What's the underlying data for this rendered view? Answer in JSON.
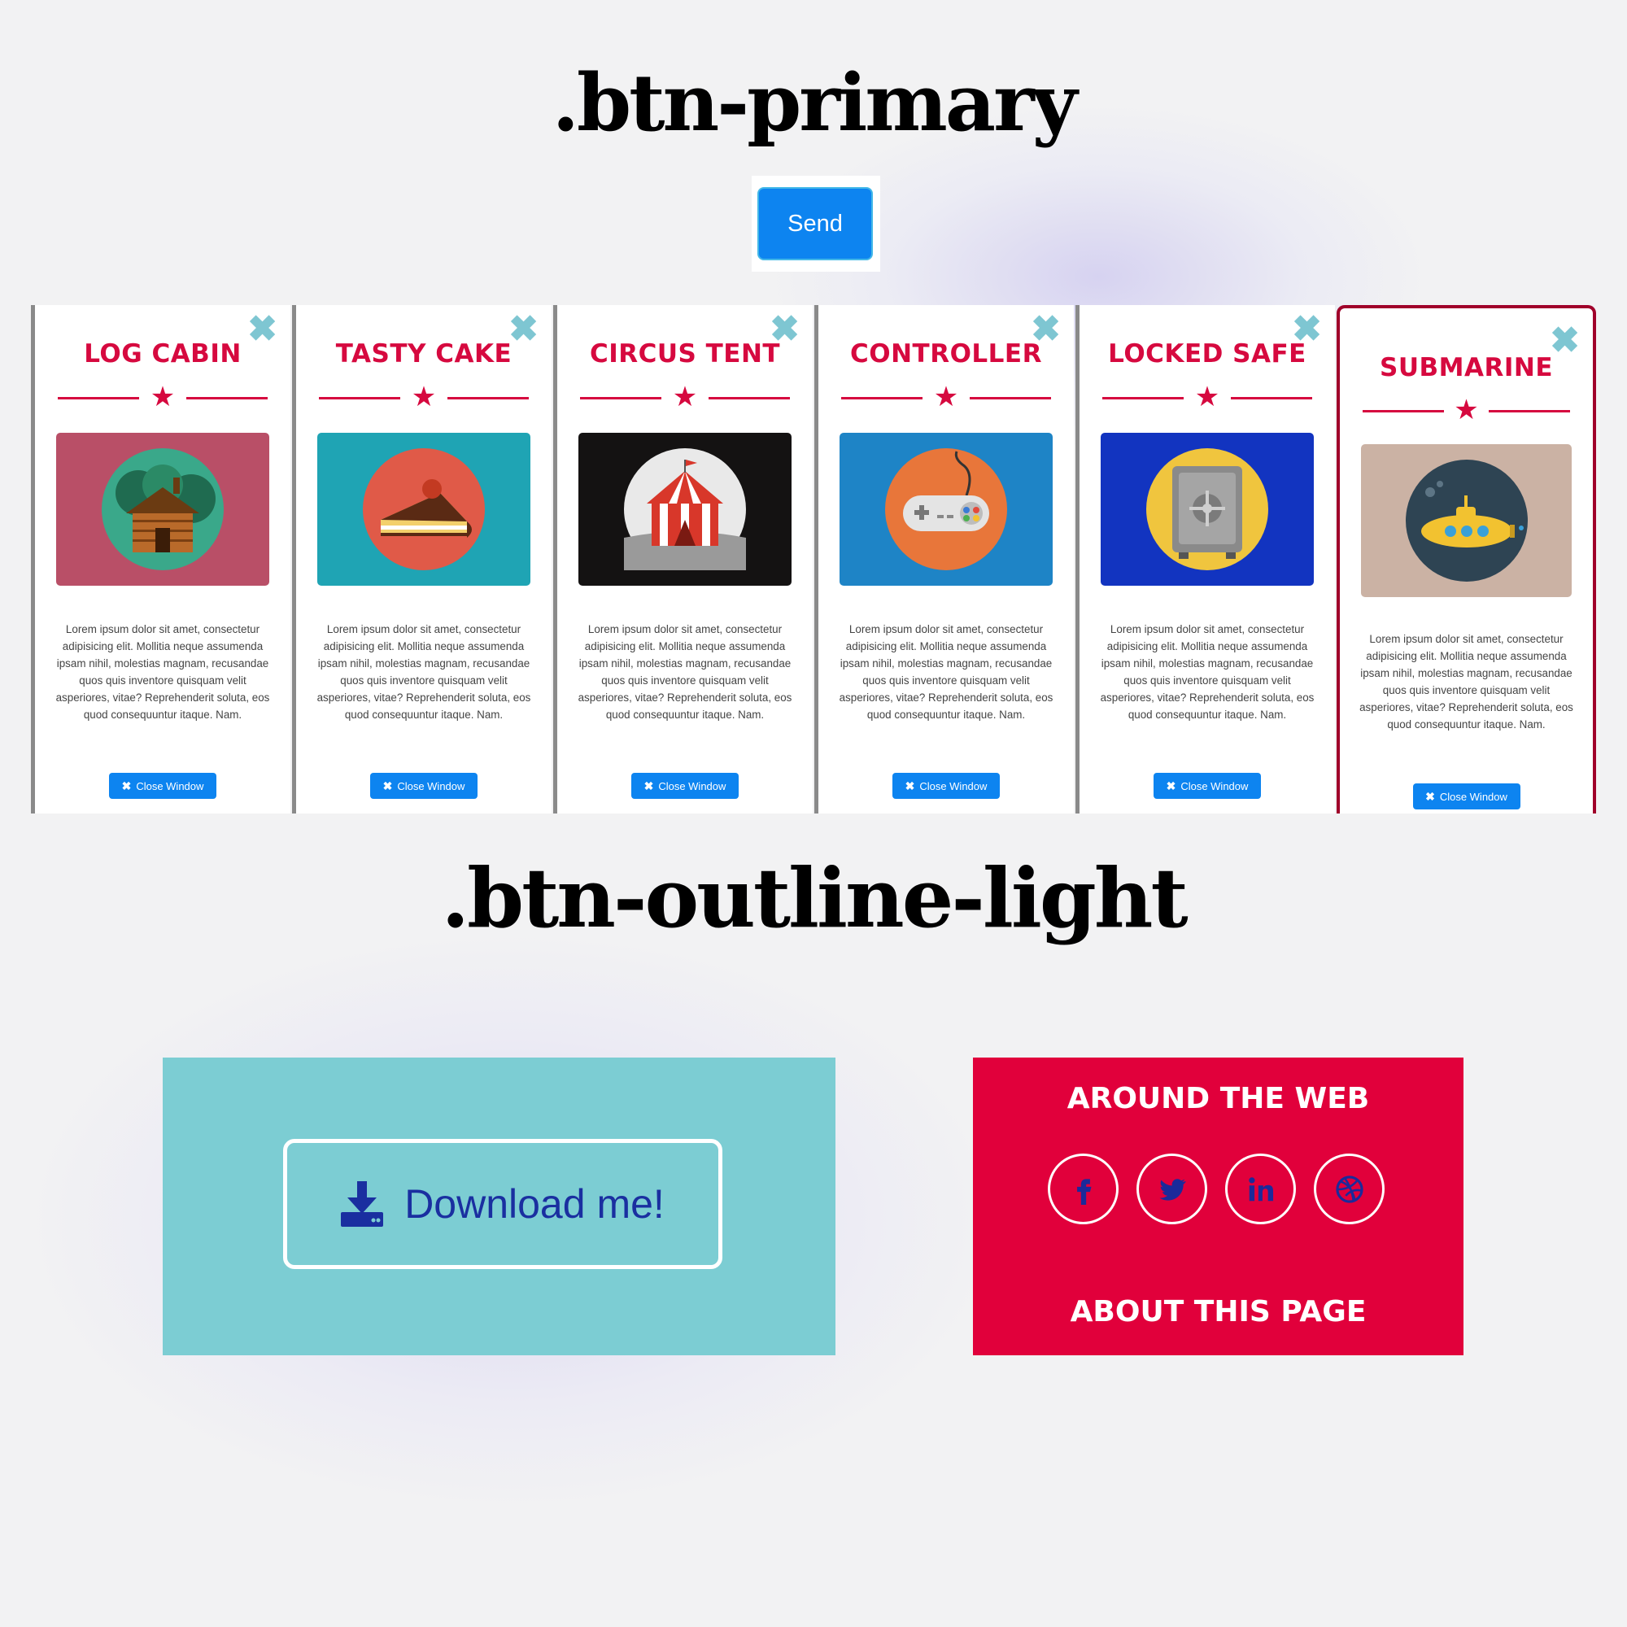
{
  "headings": {
    "primary": ".btn-primary",
    "outline": ".btn-outline-light"
  },
  "send_button": {
    "label": "Send"
  },
  "cards": [
    {
      "title": "LOG CABIN",
      "art_bg": "#b94f67",
      "icon": "log-cabin-icon"
    },
    {
      "title": "TASTY CAKE",
      "art_bg": "#1fa4b4",
      "icon": "cake-icon"
    },
    {
      "title": "CIRCUS TENT",
      "art_bg": "#141212",
      "icon": "circus-tent-icon"
    },
    {
      "title": "CONTROLLER",
      "art_bg": "#1e84c6",
      "icon": "controller-icon"
    },
    {
      "title": "LOCKED SAFE",
      "art_bg": "#1234c0",
      "icon": "safe-icon"
    },
    {
      "title": "SUBMARINE",
      "art_bg": "#cbb2a4",
      "icon": "submarine-icon"
    }
  ],
  "card_common": {
    "description": "Lorem ipsum dolor sit amet, consectetur adipisicing elit. Mollitia neque assumenda ipsam nihil, molestias magnam, recusandae quos quis inventore quisquam velit asperiores, vitae? Reprehenderit soluta, eos quod consequuntur itaque. Nam.",
    "close_label": "Close Window",
    "close_x": "✖",
    "close_icon_glyph": "✖"
  },
  "download_button": {
    "label": "Download me!"
  },
  "web_panel": {
    "title": "AROUND THE WEB",
    "footer_title": "ABOUT THIS PAGE",
    "socials": [
      "facebook-icon",
      "twitter-icon",
      "linkedin-icon",
      "dribbble-icon"
    ]
  },
  "colors": {
    "primary": "#0d84f0",
    "accent": "#d6093f",
    "teal": "#7ccdd3",
    "crimson": "#e1003b",
    "navy": "#1a2fa0"
  }
}
